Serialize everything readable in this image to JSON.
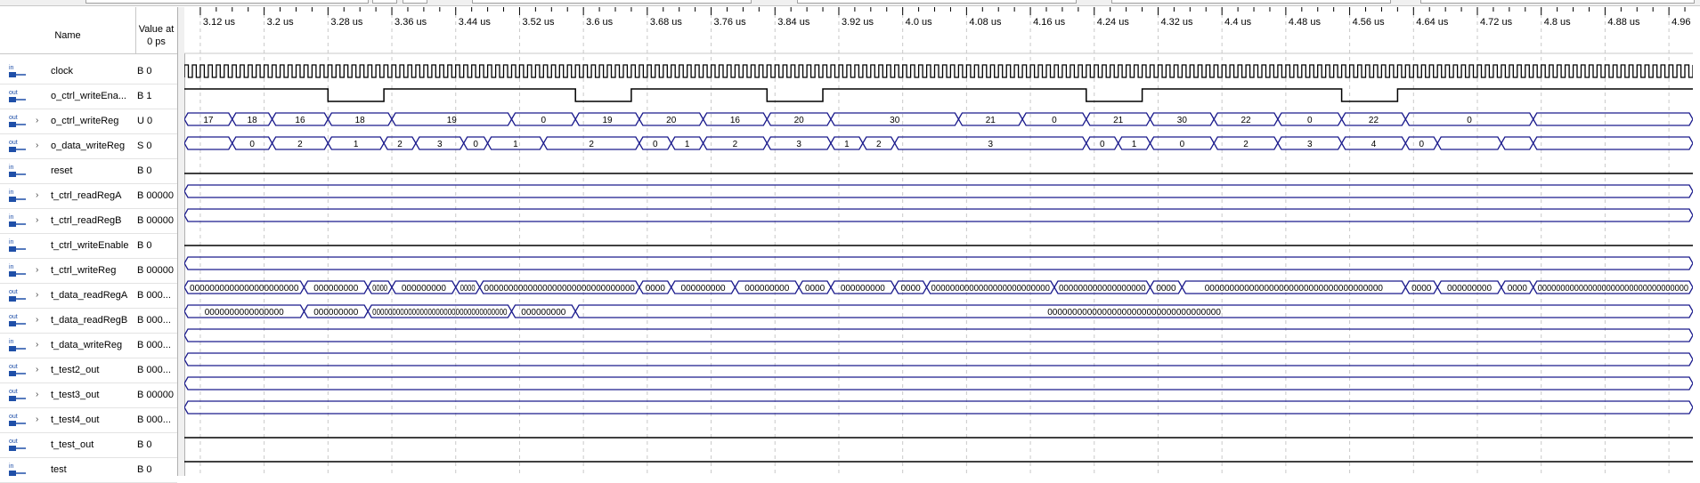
{
  "header": {
    "name_col": "Name",
    "value_col_line1": "Value at",
    "value_col_line2": "0 ps"
  },
  "time_axis": {
    "labels": [
      "3.12 us",
      "3.2 us",
      "3.28 us",
      "3.36 us",
      "3.44 us",
      "3.52 us",
      "3.6 us",
      "3.68 us",
      "3.76 us",
      "3.84 us",
      "3.92 us",
      "4.0 us",
      "4.08 us",
      "4.16 us",
      "4.24 us",
      "4.32 us",
      "4.4 us",
      "4.48 us",
      "4.56 us",
      "4.64 us",
      "4.72 us",
      "4.8 us",
      "4.88 us",
      "4.96 us"
    ],
    "start_us": 3.1,
    "end_us": 4.99
  },
  "colors": {
    "bus": "#1a1a8c",
    "signal": "#000000",
    "grid": "#c9c9c9",
    "icon_blue": "#1f4fa8"
  },
  "signals": [
    {
      "dir": "in",
      "name": "clock",
      "value": "B 0",
      "kind": "clock",
      "expandable": false
    },
    {
      "dir": "out",
      "name": "o_ctrl_writeEna...",
      "value": "B 1",
      "kind": "bit",
      "expandable": false,
      "level_start": 1,
      "lows": [
        [
          3.28,
          3.35
        ],
        [
          3.59,
          3.66
        ],
        [
          3.83,
          3.9
        ],
        [
          4.23,
          4.3
        ],
        [
          4.55,
          4.62
        ]
      ]
    },
    {
      "dir": "out",
      "name": "o_ctrl_writeReg",
      "value": "U 0",
      "kind": "bus",
      "expandable": true,
      "edges": [
        3.1,
        3.16,
        3.21,
        3.28,
        3.36,
        3.51,
        3.59,
        3.67,
        3.75,
        3.83,
        3.91,
        4.07,
        4.15,
        4.23,
        4.31,
        4.39,
        4.47,
        4.55,
        4.63,
        4.79,
        4.99
      ],
      "labels": [
        "17",
        "18",
        "16",
        "18",
        "19",
        "0",
        "19",
        "20",
        "16",
        "20",
        "30",
        "21",
        "0",
        "21",
        "30",
        "22",
        "0",
        "22",
        "0"
      ]
    },
    {
      "dir": "out",
      "name": "o_data_writeReg",
      "value": "S 0",
      "kind": "bus",
      "expandable": true,
      "edges": [
        3.1,
        3.16,
        3.21,
        3.28,
        3.35,
        3.39,
        3.45,
        3.48,
        3.55,
        3.67,
        3.71,
        3.75,
        3.83,
        3.91,
        3.95,
        3.99,
        4.23,
        4.27,
        4.31,
        4.39,
        4.47,
        4.55,
        4.63,
        4.67,
        4.75,
        4.79,
        4.99
      ],
      "labels": [
        "",
        "0",
        "2",
        "1",
        "2",
        "3",
        "0",
        "1",
        "2",
        "0",
        "1",
        "2",
        "3",
        "1",
        "2",
        "3",
        "0",
        "1",
        "0",
        "2",
        "3",
        "4",
        "0"
      ]
    },
    {
      "dir": "in",
      "name": "reset",
      "value": "B 0",
      "kind": "bit",
      "expandable": false,
      "level_start": 0,
      "lows": []
    },
    {
      "dir": "in",
      "name": "t_ctrl_readRegA",
      "value": "B 00000",
      "kind": "bus",
      "expandable": true,
      "edges": [
        3.1,
        4.99
      ],
      "labels": [
        ""
      ]
    },
    {
      "dir": "in",
      "name": "t_ctrl_readRegB",
      "value": "B 00000",
      "kind": "bus",
      "expandable": true,
      "edges": [
        3.1,
        4.99
      ],
      "labels": [
        ""
      ]
    },
    {
      "dir": "in",
      "name": "t_ctrl_writeEnable",
      "value": "B 0",
      "kind": "bit",
      "expandable": false,
      "level_start": 0,
      "lows": []
    },
    {
      "dir": "in",
      "name": "t_ctrl_writeReg",
      "value": "B 00000",
      "kind": "bus",
      "expandable": true,
      "edges": [
        3.1,
        4.99
      ],
      "labels": [
        ""
      ]
    },
    {
      "dir": "out",
      "name": "t_data_readRegA",
      "value": "B 000...",
      "kind": "bus",
      "expandable": true,
      "edges": [
        3.1,
        3.25,
        3.33,
        3.36,
        3.44,
        3.47,
        3.67,
        3.71,
        3.79,
        3.87,
        3.91,
        3.99,
        4.03,
        4.19,
        4.31,
        4.35,
        4.63,
        4.67,
        4.75,
        4.79,
        4.99
      ],
      "labels": [
        "0000000000000000000000",
        "000000000",
        "0000",
        "000000000",
        "0000",
        "0000000000000000000000000000000",
        "0000",
        "000000000",
        "000000000",
        "0000",
        "000000000",
        "0000",
        "0000000000000000000000000",
        "000000000000000000",
        "0000",
        "000000000000000000000000000000000000",
        "0000",
        "000000000",
        "0000",
        "000000000000000000000000000000000"
      ]
    },
    {
      "dir": "out",
      "name": "t_data_readRegB",
      "value": "B 000...",
      "kind": "bus",
      "expandable": true,
      "edges": [
        3.1,
        3.25,
        3.33,
        3.51,
        3.59,
        4.99
      ],
      "labels": [
        "0000000000000000",
        "000000000",
        "0000000000000000000000000000000000",
        "000000000",
        "00000000000000000000000000000000000"
      ]
    },
    {
      "dir": "in",
      "name": "t_data_writeReg",
      "value": "B 000...",
      "kind": "bus",
      "expandable": true,
      "edges": [
        3.1,
        4.99
      ],
      "labels": [
        ""
      ]
    },
    {
      "dir": "out",
      "name": "t_test2_out",
      "value": "B 000...",
      "kind": "bus",
      "expandable": true,
      "edges": [
        3.1,
        4.99
      ],
      "labels": [
        ""
      ]
    },
    {
      "dir": "out",
      "name": "t_test3_out",
      "value": "B 00000",
      "kind": "bus",
      "expandable": true,
      "edges": [
        3.1,
        4.99
      ],
      "labels": [
        ""
      ]
    },
    {
      "dir": "out",
      "name": "t_test4_out",
      "value": "B 000...",
      "kind": "bus",
      "expandable": true,
      "edges": [
        3.1,
        4.99
      ],
      "labels": [
        ""
      ]
    },
    {
      "dir": "out",
      "name": "t_test_out",
      "value": "B 0",
      "kind": "bit",
      "expandable": false,
      "level_start": 0,
      "lows": []
    },
    {
      "dir": "in",
      "name": "test",
      "value": "B 0",
      "kind": "bit",
      "expandable": false,
      "level_start": 0,
      "lows": []
    }
  ]
}
